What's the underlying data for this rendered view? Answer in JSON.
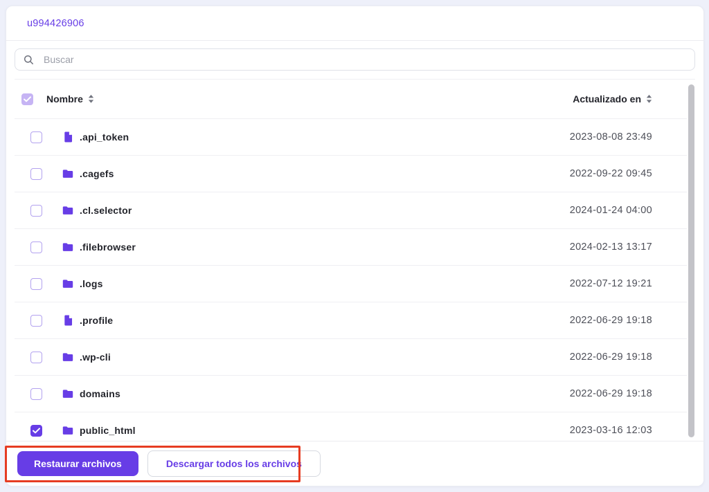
{
  "window": {
    "title": "u994426906"
  },
  "search": {
    "placeholder": "Buscar",
    "icon": "magnifier"
  },
  "table": {
    "select_all_state": "indeterminate",
    "columns": [
      {
        "label": "Nombre",
        "sortable": true
      },
      {
        "label": "Actualizado en",
        "sortable": true
      }
    ],
    "rows": [
      {
        "name": ".api_token",
        "type": "file",
        "updated": "2023-08-08 23:49",
        "checked": false
      },
      {
        "name": ".cagefs",
        "type": "folder",
        "updated": "2022-09-22 09:45",
        "checked": false
      },
      {
        "name": ".cl.selector",
        "type": "folder",
        "updated": "2024-01-24 04:00",
        "checked": false
      },
      {
        "name": ".filebrowser",
        "type": "folder",
        "updated": "2024-02-13 13:17",
        "checked": false
      },
      {
        "name": ".logs",
        "type": "folder",
        "updated": "2022-07-12 19:21",
        "checked": false
      },
      {
        "name": ".profile",
        "type": "file",
        "updated": "2022-06-29 19:18",
        "checked": false
      },
      {
        "name": ".wp-cli",
        "type": "folder",
        "updated": "2022-06-29 19:18",
        "checked": false
      },
      {
        "name": "domains",
        "type": "folder",
        "updated": "2022-06-29 19:18",
        "checked": false
      },
      {
        "name": "public_html",
        "type": "folder",
        "updated": "2023-03-16 12:03",
        "checked": true
      }
    ]
  },
  "footer": {
    "restore_button": "Restaurar archivos",
    "download_button": "Descargar todos los archivos"
  },
  "icons": {
    "search": "magnifier-icon",
    "sort": "sort-arrows-icon",
    "folder": "folder-icon",
    "file": "document-icon",
    "check": "checkmark-icon"
  },
  "annotation": {
    "type": "highlight-box",
    "color": "#e63c22"
  },
  "colors": {
    "brand_purple": "#673de6",
    "checkbox_partial": "#c6b4f4",
    "checkbox_border": "#b3a2ef",
    "text_dark": "#23242b",
    "text_muted": "#4d4f58",
    "placeholder": "#9b9ea8",
    "divider": "#ececf1",
    "page_bg": "#eef0fa",
    "scrollbar": "#c3c3c8",
    "annotation_red": "#e63c22"
  }
}
